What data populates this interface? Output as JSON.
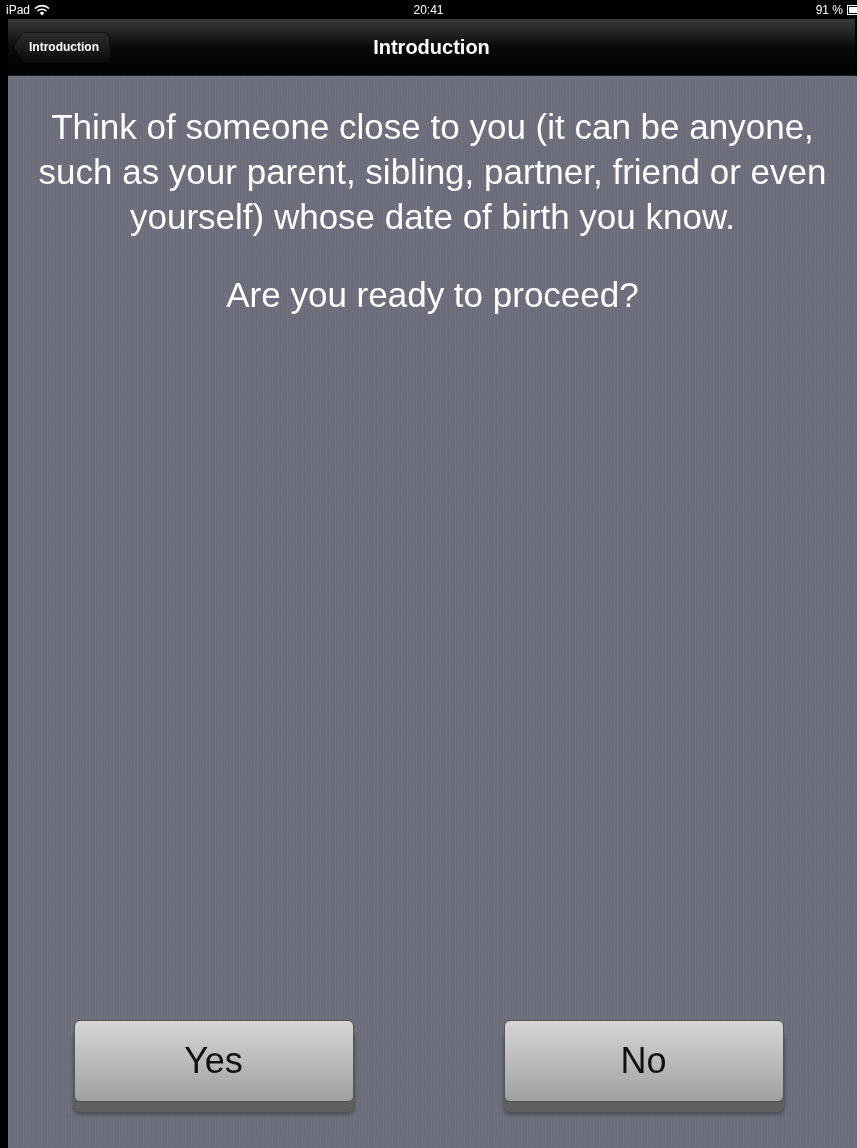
{
  "status_bar": {
    "device": "iPad",
    "time": "20:41",
    "battery": "91 %"
  },
  "nav_bar": {
    "back_button": "Introduction",
    "title": "Introduction"
  },
  "message": "Think of someone close to you (it can be anyone, such as your parent, sibling, partner, friend or even yourself) whose date of birth you know.",
  "question": "Are you ready to proceed?",
  "buttons": [
    {
      "label": "Yes"
    },
    {
      "label": "No"
    }
  ]
}
